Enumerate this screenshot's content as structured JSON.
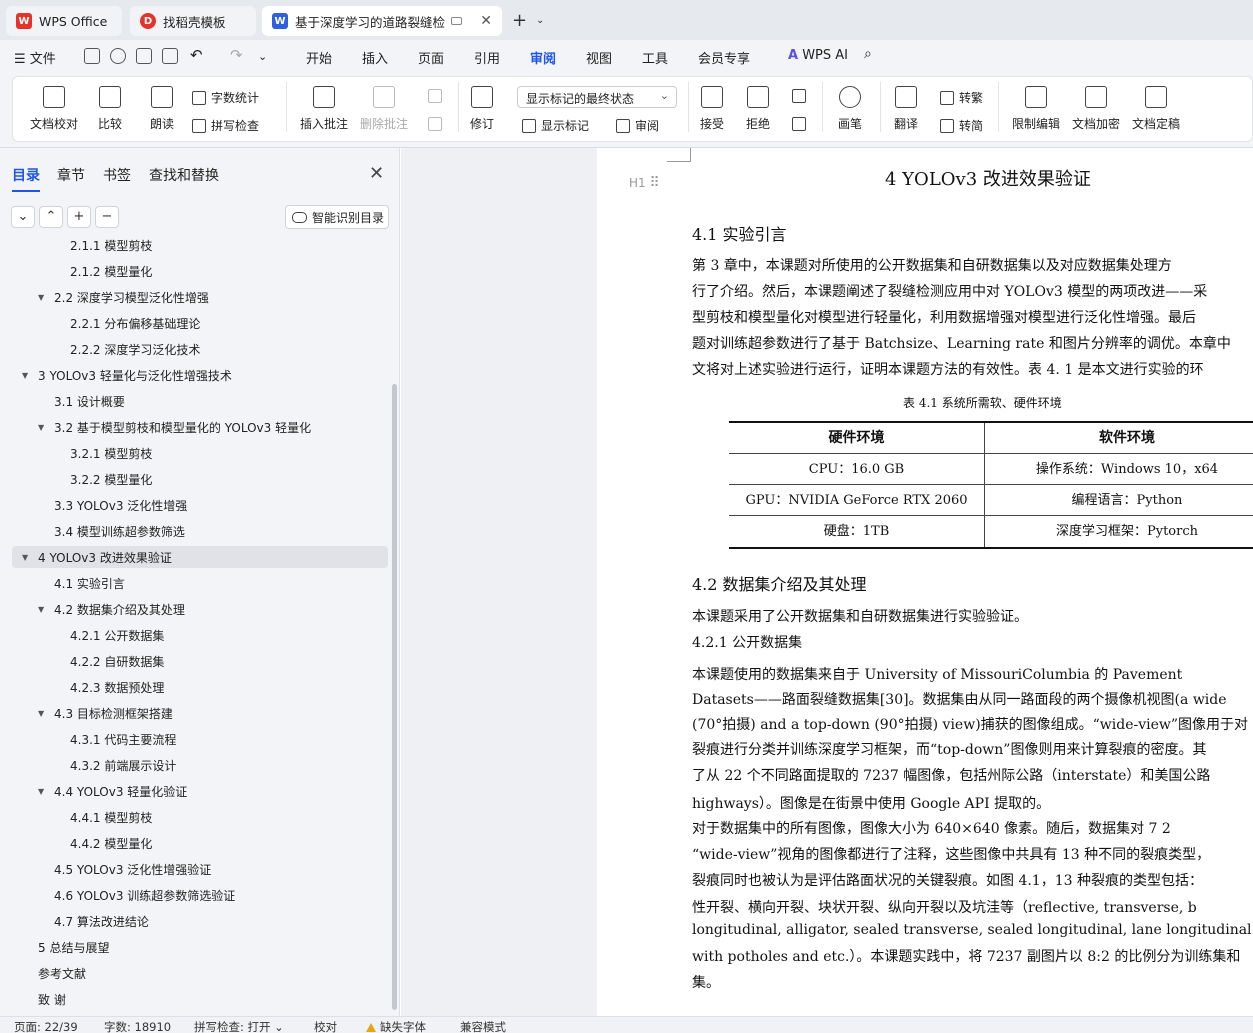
{
  "tabs": [
    {
      "label": "WPS Office",
      "icon": "wps-logo-icon"
    },
    {
      "label": "找稻壳模板",
      "icon": "docer-icon"
    },
    {
      "label": "基于深度学习的道路裂缝检测",
      "icon": "word-doc-icon"
    }
  ],
  "menu": {
    "file": "文件",
    "items": [
      "开始",
      "插入",
      "页面",
      "引用",
      "审阅",
      "视图",
      "工具",
      "会员专享"
    ],
    "active": "审阅",
    "ai": "WPS AI"
  },
  "ribbon": {
    "doc_check": "文档校对",
    "compare": "比较",
    "read_aloud": "朗读",
    "word_count": "字数统计",
    "spell_check": "拼写检查",
    "insert_comment": "插入批注",
    "delete_comment": "删除批注",
    "track": "修订",
    "markup_dropdown": "显示标记的最终状态",
    "show_markup": "显示标记",
    "review_pane": "审阅",
    "accept": "接受",
    "reject": "拒绝",
    "ink": "画笔",
    "translate": "翻译",
    "to_trad": "转繁",
    "to_simp": "转简",
    "restrict": "限制编辑",
    "encrypt": "文档加密",
    "finalize": "文档定稿"
  },
  "nav": {
    "tabs": [
      "目录",
      "章节",
      "书签",
      "查找和替换"
    ],
    "active_tab": "目录",
    "smart_toc": "智能识别目录",
    "items": [
      {
        "label": "2.1.1 模型剪枝",
        "level": 3,
        "arrow": ""
      },
      {
        "label": "2.1.2 模型量化",
        "level": 3,
        "arrow": ""
      },
      {
        "label": "2.2 深度学习模型泛化性增强",
        "level": 2,
        "arrow": "▼"
      },
      {
        "label": "2.2.1 分布偏移基础理论",
        "level": 3,
        "arrow": ""
      },
      {
        "label": "2.2.2 深度学习泛化技术",
        "level": 3,
        "arrow": ""
      },
      {
        "label": "3 YOLOv3 轻量化与泛化性增强技术",
        "level": 1,
        "arrow": "▼"
      },
      {
        "label": "3.1 设计概要",
        "level": 2,
        "arrow": ""
      },
      {
        "label": "3.2 基于模型剪枝和模型量化的 YOLOv3 轻量化",
        "level": 2,
        "arrow": "▼"
      },
      {
        "label": "3.2.1 模型剪枝",
        "level": 3,
        "arrow": ""
      },
      {
        "label": "3.2.2 模型量化",
        "level": 3,
        "arrow": ""
      },
      {
        "label": "3.3 YOLOv3 泛化性增强",
        "level": 2,
        "arrow": ""
      },
      {
        "label": "3.4 模型训练超参数筛选",
        "level": 2,
        "arrow": ""
      },
      {
        "label": "4 YOLOv3 改进效果验证",
        "level": 1,
        "arrow": "▼",
        "selected": true
      },
      {
        "label": "4.1 实验引言",
        "level": 2,
        "arrow": ""
      },
      {
        "label": "4.2 数据集介绍及其处理",
        "level": 2,
        "arrow": "▼"
      },
      {
        "label": "4.2.1 公开数据集",
        "level": 3,
        "arrow": ""
      },
      {
        "label": "4.2.2 自研数据集",
        "level": 3,
        "arrow": ""
      },
      {
        "label": "4.2.3 数据预处理",
        "level": 3,
        "arrow": ""
      },
      {
        "label": "4.3 目标检测框架搭建",
        "level": 2,
        "arrow": "▼"
      },
      {
        "label": "4.3.1 代码主要流程",
        "level": 3,
        "arrow": ""
      },
      {
        "label": "4.3.2 前端展示设计",
        "level": 3,
        "arrow": ""
      },
      {
        "label": "4.4 YOLOv3 轻量化验证",
        "level": 2,
        "arrow": "▼"
      },
      {
        "label": "4.4.1 模型剪枝",
        "level": 3,
        "arrow": ""
      },
      {
        "label": "4.4.2 模型量化",
        "level": 3,
        "arrow": ""
      },
      {
        "label": "4.5 YOLOv3 泛化性增强验证",
        "level": 2,
        "arrow": ""
      },
      {
        "label": "4.6 YOLOv3 训练超参数筛选验证",
        "level": 2,
        "arrow": ""
      },
      {
        "label": "4.7 算法改进结论",
        "level": 2,
        "arrow": ""
      },
      {
        "label": "5 总结与展望",
        "level": 1,
        "arrow": ""
      },
      {
        "label": "参考文献",
        "level": 1,
        "arrow": ""
      },
      {
        "label": "致 谢",
        "level": 1,
        "arrow": ""
      }
    ]
  },
  "doc": {
    "heading_mark": "H1",
    "chapter_title": "4 YOLOv3 改进效果验证",
    "sec41": "4.1  实验引言",
    "p41": [
      "    第 3 章中，本课题对所使用的公开数据集和自研数据集以及对应数据集处理方",
      "行了介绍。然后，本课题阐述了裂缝检测应用中对 YOLOv3 模型的两项改进——采",
      "型剪枝和模型量化对模型进行轻量化，利用数据增强对模型进行泛化性增强。最后",
      "题对训练超参数进行了基于 Batchsize、Learning rate 和图片分辨率的调优。本章中",
      "文将对上述实验进行运行，证明本课题方法的有效性。表 4. 1 是本文进行实验的环"
    ],
    "table_caption": "表 4.1  系统所需软、硬件环境",
    "table": {
      "headers": [
        "硬件环境",
        "软件环境"
      ],
      "rows": [
        [
          "CPU：16.0 GB",
          "操作系统：Windows 10，x64"
        ],
        [
          "GPU：NVIDIA GeForce RTX 2060",
          "编程语言：Python"
        ],
        [
          "硬盘：1TB",
          "深度学习框架：Pytorch"
        ]
      ]
    },
    "sec42": "4.2  数据集介绍及其处理",
    "p42": "    本课题采用了公开数据集和自研数据集进行实验验证。",
    "sub421": "4.2.1  公开数据集",
    "p421": [
      "    本课题使用的数据集来自于 University of MissouriColumbia 的 Pavement",
      "Datasets——路面裂缝数据集[30]。数据集由从同一路面段的两个摄像机视图(a wide",
      "(70°拍摄) and a top-down (90°拍摄) view)捕获的图像组成。“wide-view”图像用于对",
      "裂痕进行分类并训练深度学习框架，而“top-down”图像则用来计算裂痕的密度。其",
      "了从 22 个不同路面提取的 7237 幅图像，包括州际公路（interstate）和美国公路",
      "highways）。图像是在街景中使用 Google API 提取的。",
      "    对于数据集中的所有图像，图像大小为 640×640 像素。随后，数据集对 7 2",
      "“wide-view”视角的图像都进行了注释，这些图像中共具有 13 种不同的裂痕类型，",
      "裂痕同时也被认为是评估路面状况的关键裂痕。如图 4.1，13 种裂痕的类型包括：",
      "性开裂、横向开裂、块状开裂、纵向开裂以及坑洼等（reflective, transverse, b",
      "longitudinal, alligator, sealed transverse, sealed longitudinal, lane longitudinal cracking",
      "with potholes and etc.）。本课题实践中，将 7237 副图片以 8:2 的比例分为训练集和",
      "集。"
    ]
  },
  "status": {
    "page": "页面: 22/39",
    "words": "字数: 18910",
    "spell": "拼写检查: 打开",
    "proof": "校对",
    "missing_font": "缺失字体",
    "compat": "兼容模式"
  },
  "colors": {
    "accent": "#1e56e6",
    "wps_red": "#e5322b",
    "word_blue": "#2f5fdc"
  }
}
